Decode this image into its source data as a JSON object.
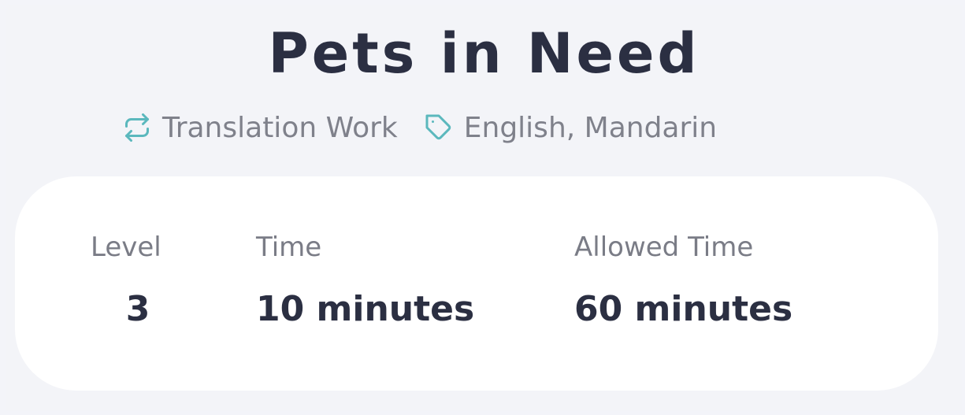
{
  "header": {
    "title": "Pets in Need",
    "category": {
      "label": "Translation Work",
      "icon": "repeat-icon"
    },
    "tags": {
      "label": "English, Mandarin",
      "icon": "tag-icon"
    }
  },
  "stats": [
    {
      "label": "Level",
      "value": "3"
    },
    {
      "label": "Time",
      "value": "10 minutes"
    },
    {
      "label": "Allowed Time",
      "value": "60 minutes"
    }
  ],
  "colors": {
    "accent": "#5bb8bd",
    "title_text": "#2b2f42",
    "muted_text": "#7f818b",
    "background": "#f3f4f8",
    "card": "#ffffff"
  }
}
